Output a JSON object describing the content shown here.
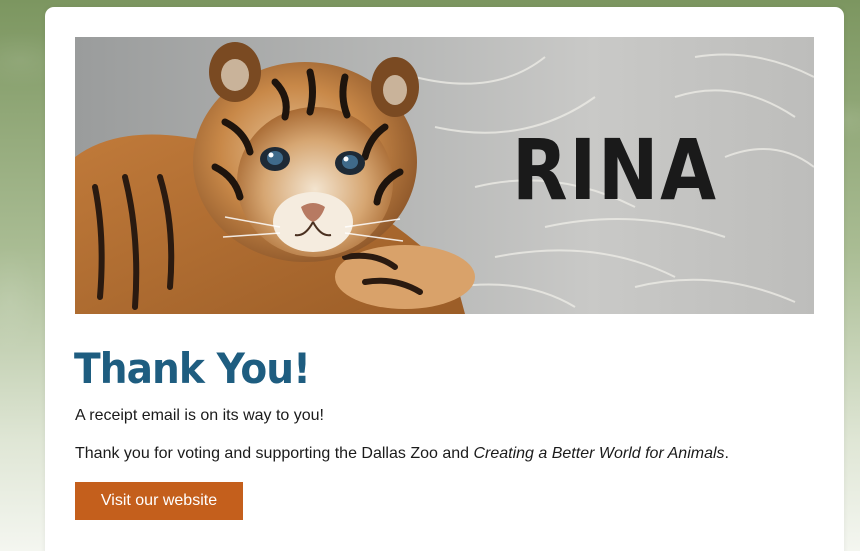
{
  "banner": {
    "name_text": "RINA",
    "image_alt": "Tiger cub"
  },
  "confirmation": {
    "title": "Thank You!",
    "receipt_text": "A receipt email is on its way to you!",
    "thanks_prefix": "Thank you for voting and supporting the Dallas Zoo and ",
    "thanks_emphasis": "Creating a Better World for Animals",
    "thanks_suffix": "."
  },
  "actions": {
    "website_button_label": "Visit our website"
  },
  "colors": {
    "title": "#1e5d80",
    "button": "#c45f1c",
    "page_background": "#a9bc93"
  }
}
